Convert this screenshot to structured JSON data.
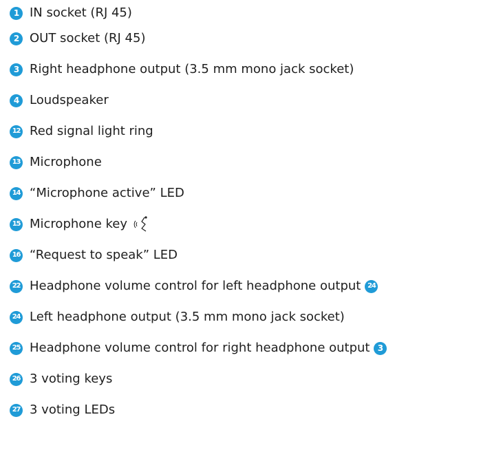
{
  "accent_color": "#1f9bd7",
  "text_color": "#1e1e1e",
  "items": [
    {
      "number": "1",
      "text": "IN socket (RJ 45)"
    },
    {
      "number": "2",
      "text": "OUT socket (RJ 45)"
    },
    {
      "number": "3",
      "text": "Right headphone output (3.5 mm mono jack socket)"
    },
    {
      "number": "4",
      "text": "Loudspeaker"
    },
    {
      "number": "12",
      "text": "Red signal light ring"
    },
    {
      "number": "13",
      "text": "Microphone"
    },
    {
      "number": "14",
      "text": "“Microphone active” LED"
    },
    {
      "number": "15",
      "text": "Microphone key",
      "icon": "microphone-key-icon"
    },
    {
      "number": "16",
      "text": "“Request to speak” LED"
    },
    {
      "number": "22",
      "text": "Headphone volume control for left headphone output",
      "ref": "24"
    },
    {
      "number": "24",
      "text": "Left headphone output (3.5 mm mono jack socket)"
    },
    {
      "number": "25",
      "text": "Headphone volume control for right headphone output",
      "ref": "3"
    },
    {
      "number": "26",
      "text": "3 voting keys"
    },
    {
      "number": "27",
      "text": "3 voting LEDs"
    }
  ]
}
